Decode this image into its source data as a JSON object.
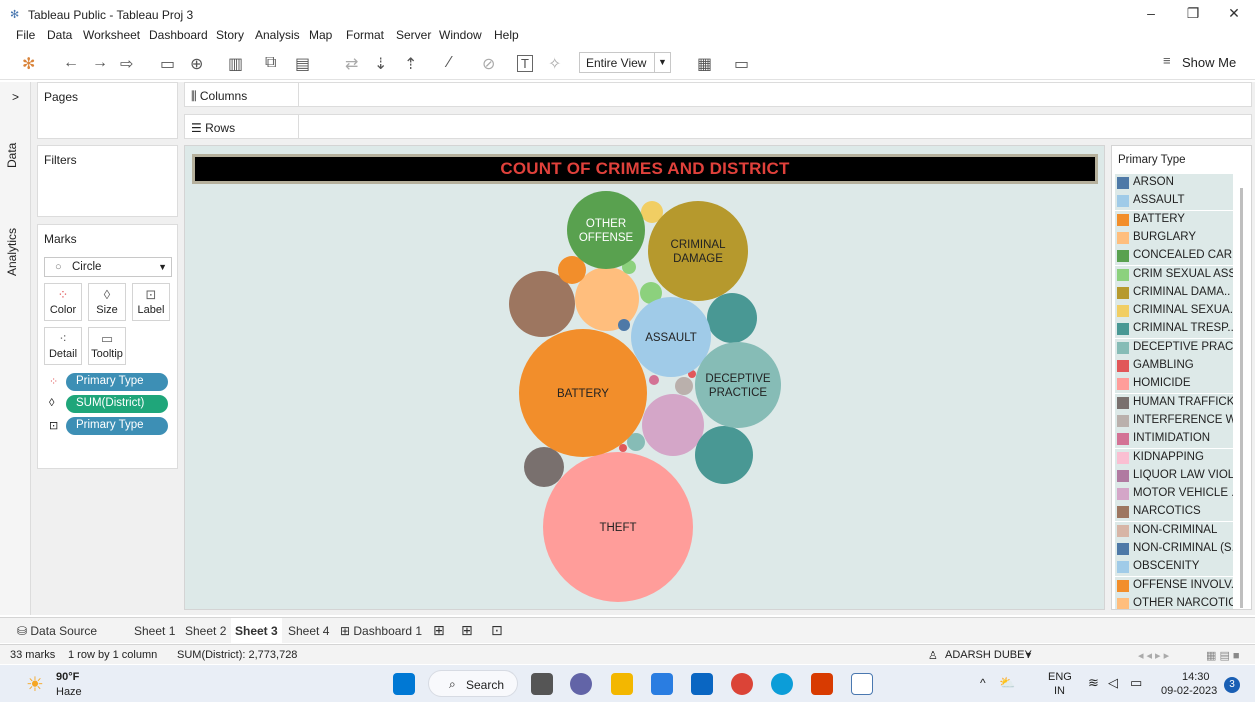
{
  "window": {
    "title": "Tableau Public - Tableau Proj 3",
    "minimize": "–",
    "restore": "❐",
    "close": "✕"
  },
  "menu": [
    "File",
    "Data",
    "Worksheet",
    "Dashboard",
    "Story",
    "Analysis",
    "Map",
    "Format",
    "Server",
    "Window",
    "Help"
  ],
  "toolbar": {
    "fit_value": "Entire View",
    "show_me": "Show Me"
  },
  "side_tabs": {
    "data": "Data",
    "analytics": "Analytics"
  },
  "panels": {
    "pages": "Pages",
    "filters": "Filters",
    "marks": "Marks",
    "mark_type": "Circle",
    "cards": {
      "color": "Color",
      "size": "Size",
      "label": "Label",
      "detail": "Detail",
      "tooltip": "Tooltip"
    },
    "pills": [
      {
        "text": "Primary Type",
        "color": "#3d8fb5"
      },
      {
        "text": "SUM(District)",
        "color": "#1fa67a"
      },
      {
        "text": "Primary Type",
        "color": "#3d8fb5"
      }
    ]
  },
  "shelves": {
    "columns": "Columns",
    "rows": "Rows"
  },
  "chart_title": "COUNT OF CRIMES AND DISTRICT",
  "chart_data": {
    "type": "packed-bubble",
    "title": "COUNT OF CRIMES AND DISTRICT",
    "size_measure": "SUM(District)",
    "color_dimension": "Primary Type",
    "labeled_bubbles": [
      {
        "label": "THEFT",
        "color": "#ff9d9a"
      },
      {
        "label": "BATTERY",
        "color": "#f28e2b"
      },
      {
        "label": "CRIMINAL\nDAMAGE",
        "color": "#b6992d"
      },
      {
        "label": "ASSAULT",
        "color": "#a0cbe8"
      },
      {
        "label": "DECEPTIVE\nPRACTICE",
        "color": "#86bcb6"
      },
      {
        "label": "OTHER\nOFFENSE",
        "color": "#59a14f"
      }
    ],
    "unlabeled_colors": [
      "#9d7660",
      "#ffbe7d",
      "#499894",
      "#d4a6c8",
      "#79706e",
      "#f1ce63",
      "#8cd17d",
      "#e15759",
      "#bab0ac",
      "#ff9d9a",
      "#4e79a7",
      "#d37295"
    ]
  },
  "legend": {
    "title": "Primary Type",
    "items": [
      {
        "label": "ARSON",
        "color": "#4e79a7"
      },
      {
        "label": "ASSAULT",
        "color": "#a0cbe8"
      },
      {
        "label": "BATTERY",
        "color": "#f28e2b"
      },
      {
        "label": "BURGLARY",
        "color": "#ffbe7d"
      },
      {
        "label": "CONCEALED CAR..",
        "color": "#59a14f"
      },
      {
        "label": "CRIM SEXUAL ASS..",
        "color": "#8cd17d"
      },
      {
        "label": "CRIMINAL DAMA..",
        "color": "#b6992d"
      },
      {
        "label": "CRIMINAL SEXUA..",
        "color": "#f1ce63"
      },
      {
        "label": "CRIMINAL TRESP..",
        "color": "#499894"
      },
      {
        "label": "DECEPTIVE PRAC..",
        "color": "#86bcb6"
      },
      {
        "label": "GAMBLING",
        "color": "#e15759"
      },
      {
        "label": "HOMICIDE",
        "color": "#ff9d9a"
      },
      {
        "label": "HUMAN TRAFFICK..",
        "color": "#79706e"
      },
      {
        "label": "INTERFERENCE W..",
        "color": "#bab0ac"
      },
      {
        "label": "INTIMIDATION",
        "color": "#d37295"
      },
      {
        "label": "KIDNAPPING",
        "color": "#fabfd2"
      },
      {
        "label": "LIQUOR LAW VIOL..",
        "color": "#b07aa1"
      },
      {
        "label": "MOTOR VEHICLE ..",
        "color": "#d4a6c8"
      },
      {
        "label": "NARCOTICS",
        "color": "#9d7660"
      },
      {
        "label": "NON-CRIMINAL",
        "color": "#d7b5a6"
      },
      {
        "label": "NON-CRIMINAL (S..",
        "color": "#4e79a7"
      },
      {
        "label": "OBSCENITY",
        "color": "#a0cbe8"
      },
      {
        "label": "OFFENSE INVOLV..",
        "color": "#f28e2b"
      },
      {
        "label": "OTHER NARCOTIC..",
        "color": "#ffbe7d"
      }
    ]
  },
  "sheet_tabs": {
    "data_source": "Data Source",
    "sheets": [
      "Sheet 1",
      "Sheet 2",
      "Sheet 3",
      "Sheet 4"
    ],
    "active": "Sheet 3",
    "dashboard": "Dashboard 1"
  },
  "status": {
    "marks": "33 marks",
    "dims": "1 row by 1 column",
    "sum": "SUM(District): 2,773,728",
    "user": "ADARSH DUBEY"
  },
  "taskbar": {
    "weather_temp": "90°F",
    "weather_desc": "Haze",
    "search": "Search",
    "lang1": "ENG",
    "lang2": "IN",
    "time": "14:30",
    "date": "09-02-2023",
    "badge": "3"
  }
}
